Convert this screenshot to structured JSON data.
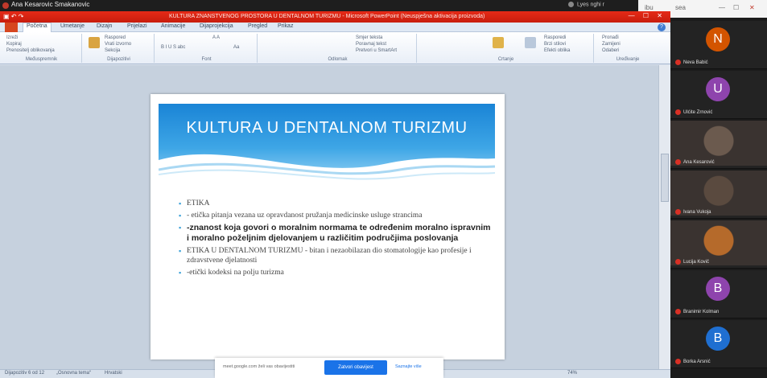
{
  "share_bar": {
    "title": "Ana Kesarovic Smakanovic",
    "right_text": "Lyes nghi r"
  },
  "os_bar": {
    "items": [
      "ibu",
      "sea",
      "—",
      "☐",
      "✕"
    ]
  },
  "ppt": {
    "caption": "KULTURA ZNANSTVENOG PROSTORA U DENTALNOM TURIZMU - Microsoft PowerPoint (Neuspješna aktivacija proizvoda)",
    "qa_icons": "▣ ↶ ↷",
    "window_buttons": "— ☐ ✕",
    "tabs": [
      "Početna",
      "Umetanje",
      "Dizajn",
      "Prijelazi",
      "Animacije",
      "Dijaprojekcija",
      "Pregled",
      "Prikaz"
    ],
    "help": "?",
    "ribbon_groups": [
      {
        "label": "Međuspremnik",
        "items": [
          "Izreži",
          "Kopiraj",
          "Prenositelj oblikovanja"
        ]
      },
      {
        "label": "Dijapozitivi",
        "items": [
          "Raspored",
          "Vrati izvorno",
          "Sekcija"
        ]
      },
      {
        "label": "Font",
        "items": [
          "A A",
          "B I U S abc",
          "Aa"
        ]
      },
      {
        "label": "Odlomak",
        "items": [
          "Smjer teksta",
          "Poravnaj tekst",
          "Pretvori u SmartArt"
        ]
      },
      {
        "label": "Crtanje",
        "items": [
          "Rasporedi",
          "Brzi stilovi",
          "Efekti oblika"
        ]
      },
      {
        "label": "Uređivanje",
        "items": [
          "Pronađi",
          "Zamijeni",
          "Odaberi"
        ]
      }
    ],
    "status": {
      "left": "Dijapozitiv 6 od 12",
      "theme": "„Osnovna tema“",
      "lang": "Hrvatski",
      "zoom": "74%"
    }
  },
  "slide": {
    "title": "KULTURA U DENTALNOM  TURIZMU",
    "bullets": [
      {
        "text": "ETIKA",
        "bold": false
      },
      {
        "text": " - etička pitanja vezana uz opravdanost pružanja medicinske usluge strancima",
        "bold": false
      },
      {
        "text": "-znanost koja govori o moralnim normama te određenim moralno ispravnim i moralno poželjnim djelovanjem u različitim područjima poslovanja",
        "bold": true
      },
      {
        "text": "ETIKA U DENTALNOM TURIZMU - bitan i nezaobilazan dio stomatologije kao profesije i zdravstvene djelatnosti",
        "bold": false
      },
      {
        "text": "-etički kodeksi na polju turizma",
        "bold": false
      }
    ]
  },
  "consent": {
    "message": "meet.google.com želi vas obavijestiti",
    "ok": "Zatvori obavijest",
    "more": "Saznajte više"
  },
  "participants": [
    {
      "name": "Neva Babić",
      "initial": "N",
      "color": "#d35400",
      "type": "avatar"
    },
    {
      "name": "Ulćite Zrnović",
      "initial": "U",
      "color": "#8e44ad",
      "type": "avatar"
    },
    {
      "name": "Ana Kesarović",
      "initial": "",
      "color": "#6b5a4e",
      "type": "video"
    },
    {
      "name": "Ivana Vukoja",
      "initial": "",
      "color": "#5a4a3f",
      "type": "video"
    },
    {
      "name": "Lucija Kovič",
      "initial": "",
      "color": "#b56a2b",
      "type": "video"
    },
    {
      "name": "Branimir Kolman",
      "initial": "B",
      "color": "#8e44ad",
      "type": "avatar"
    },
    {
      "name": "Borka Arsnić",
      "initial": "B",
      "color": "#1f6fd1",
      "type": "avatar"
    }
  ]
}
